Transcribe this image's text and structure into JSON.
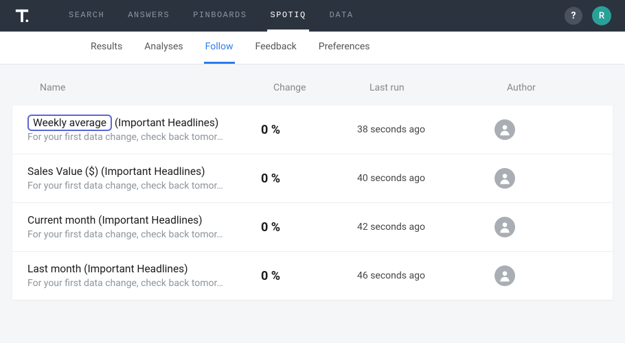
{
  "topNav": {
    "items": [
      "SEARCH",
      "ANSWERS",
      "PINBOARDS",
      "SPOTIQ",
      "DATA"
    ],
    "activeIndex": 3,
    "userInitial": "R"
  },
  "subNav": {
    "items": [
      "Results",
      "Analyses",
      "Follow",
      "Feedback",
      "Preferences"
    ],
    "activeIndex": 2
  },
  "table": {
    "headers": {
      "name": "Name",
      "change": "Change",
      "lastRun": "Last run",
      "author": "Author"
    },
    "rows": [
      {
        "titleHighlight": "Weekly average",
        "titleRest": " (Important Headlines)",
        "sub": "For your first data change, check back tomor…",
        "change": "0 %",
        "lastRun": "38 seconds ago"
      },
      {
        "title": "Sales Value ($) (Important Headlines)",
        "sub": "For your first data change, check back tomor…",
        "change": "0 %",
        "lastRun": "40 seconds ago"
      },
      {
        "title": "Current month (Important Headlines)",
        "sub": "For your first data change, check back tomor…",
        "change": "0 %",
        "lastRun": "42 seconds ago"
      },
      {
        "title": "Last month (Important Headlines)",
        "sub": "For your first data change, check back tomor…",
        "change": "0 %",
        "lastRun": "46 seconds ago"
      }
    ]
  }
}
